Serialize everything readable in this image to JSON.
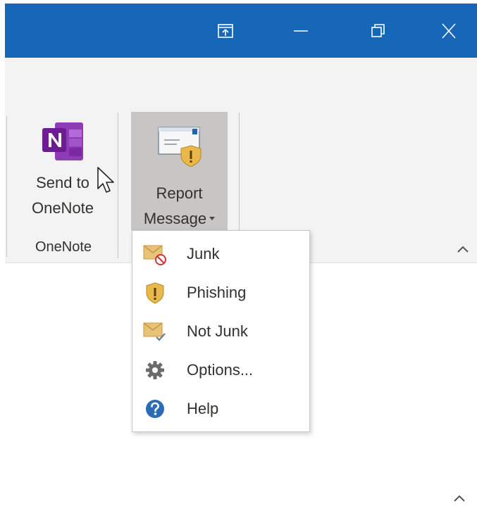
{
  "titlebar": {
    "color": "#1667b8",
    "controls": [
      "ribbon-display-options-icon",
      "minimize-icon",
      "restore-icon",
      "close-icon"
    ]
  },
  "ribbon": {
    "send_to_onenote": {
      "line1": "Send to",
      "line2": "OneNote",
      "icon": "onenote-icon"
    },
    "onenote_group_label": "OneNote",
    "report_message": {
      "line1": "Report",
      "line2": "Message",
      "icon": "report-message-icon"
    }
  },
  "menu": {
    "items": [
      {
        "label": "Junk",
        "icon": "junk-icon"
      },
      {
        "label": "Phishing",
        "icon": "phishing-shield-icon"
      },
      {
        "label": "Not Junk",
        "icon": "not-junk-icon"
      },
      {
        "label": "Options...",
        "icon": "gear-icon"
      },
      {
        "label": "Help",
        "icon": "help-icon"
      }
    ]
  }
}
